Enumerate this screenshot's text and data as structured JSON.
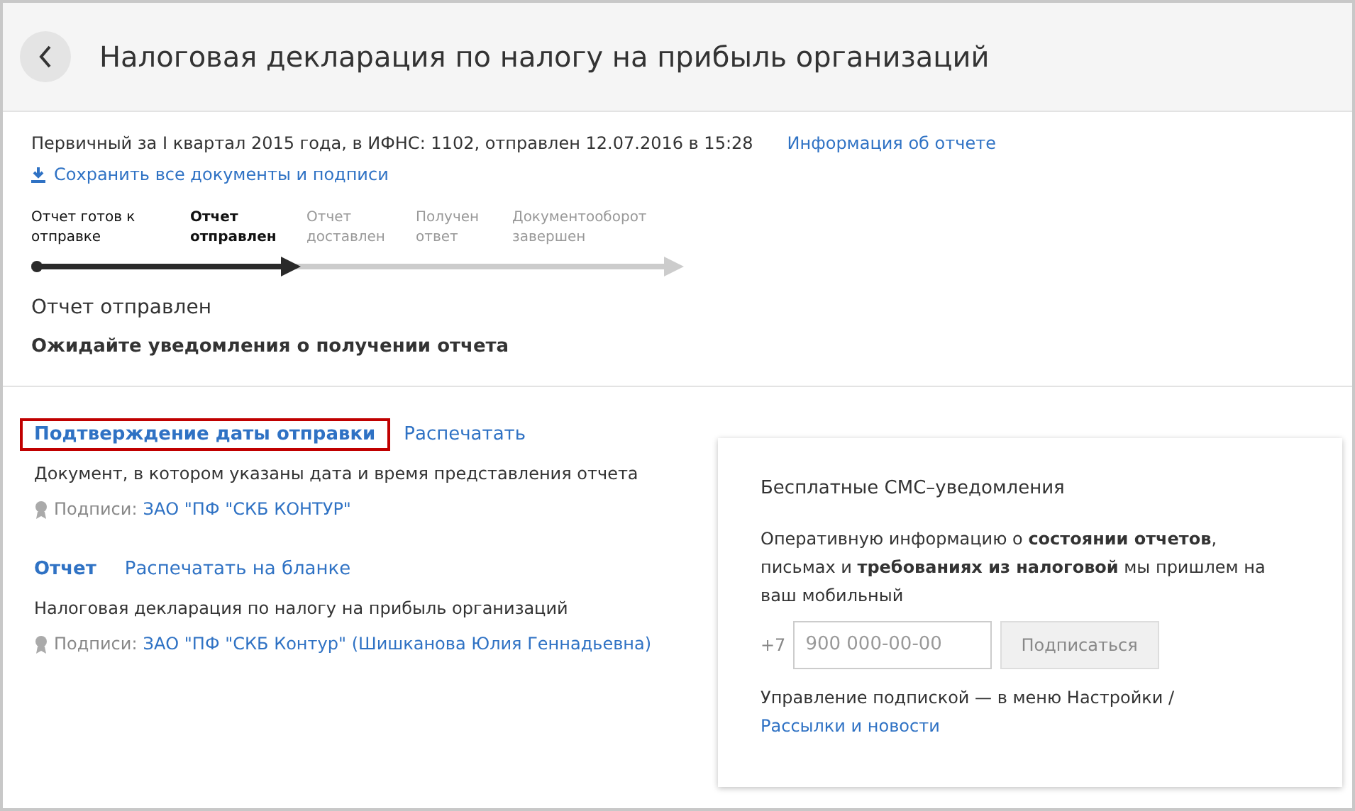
{
  "header": {
    "title": "Налоговая декларация по налогу на прибыль организаций"
  },
  "report": {
    "summary": "Первичный за I квартал 2015 года, в ИФНС: 1102, отправлен 12.07.2016 в 15:28",
    "info_link": "Информация об отчете",
    "save_link": "Сохранить все документы и подписи"
  },
  "steps": [
    {
      "label": "Отчет готов к отправке",
      "completed": true,
      "current": false
    },
    {
      "label": "Отчет отправлен",
      "completed": true,
      "current": true
    },
    {
      "label": "Отчет доставлен",
      "completed": false,
      "current": false
    },
    {
      "label": "Получен ответ",
      "completed": false,
      "current": false
    },
    {
      "label": "Документооборот завершен",
      "completed": false,
      "current": false
    }
  ],
  "status": {
    "title": "Отчет отправлен",
    "message": "Ожидайте уведомления о получении отчета"
  },
  "documents": [
    {
      "title": "Подтверждение даты отправки",
      "highlighted": true,
      "print_link": "Распечатать",
      "description": "Документ, в котором указаны дата и время представления отчета",
      "signature_label": "Подписи:",
      "signer": "ЗАО \"ПФ \"СКБ КОНТУР\""
    },
    {
      "title": "Отчет",
      "highlighted": false,
      "print_link": "Распечатать на бланке",
      "description": "Налоговая декларация по налогу на прибыль организаций",
      "signature_label": "Подписи:",
      "signer": "ЗАО \"ПФ \"СКБ Контур\" (Шишканова Юлия Геннадьевна)"
    }
  ],
  "sms": {
    "title": "Бесплатные СМС–уведомления",
    "text": "Оперативную информацию о **состоянии отчетов**, письмах и **требованиях из налоговой** мы пришлем на ваш мобильный",
    "phone_prefix": "+7",
    "placeholder": "900 000-00-00",
    "button": "Подписаться",
    "footer": "Управление подпиской — в меню Настройки /",
    "footer_link": "Рассылки и новости"
  }
}
